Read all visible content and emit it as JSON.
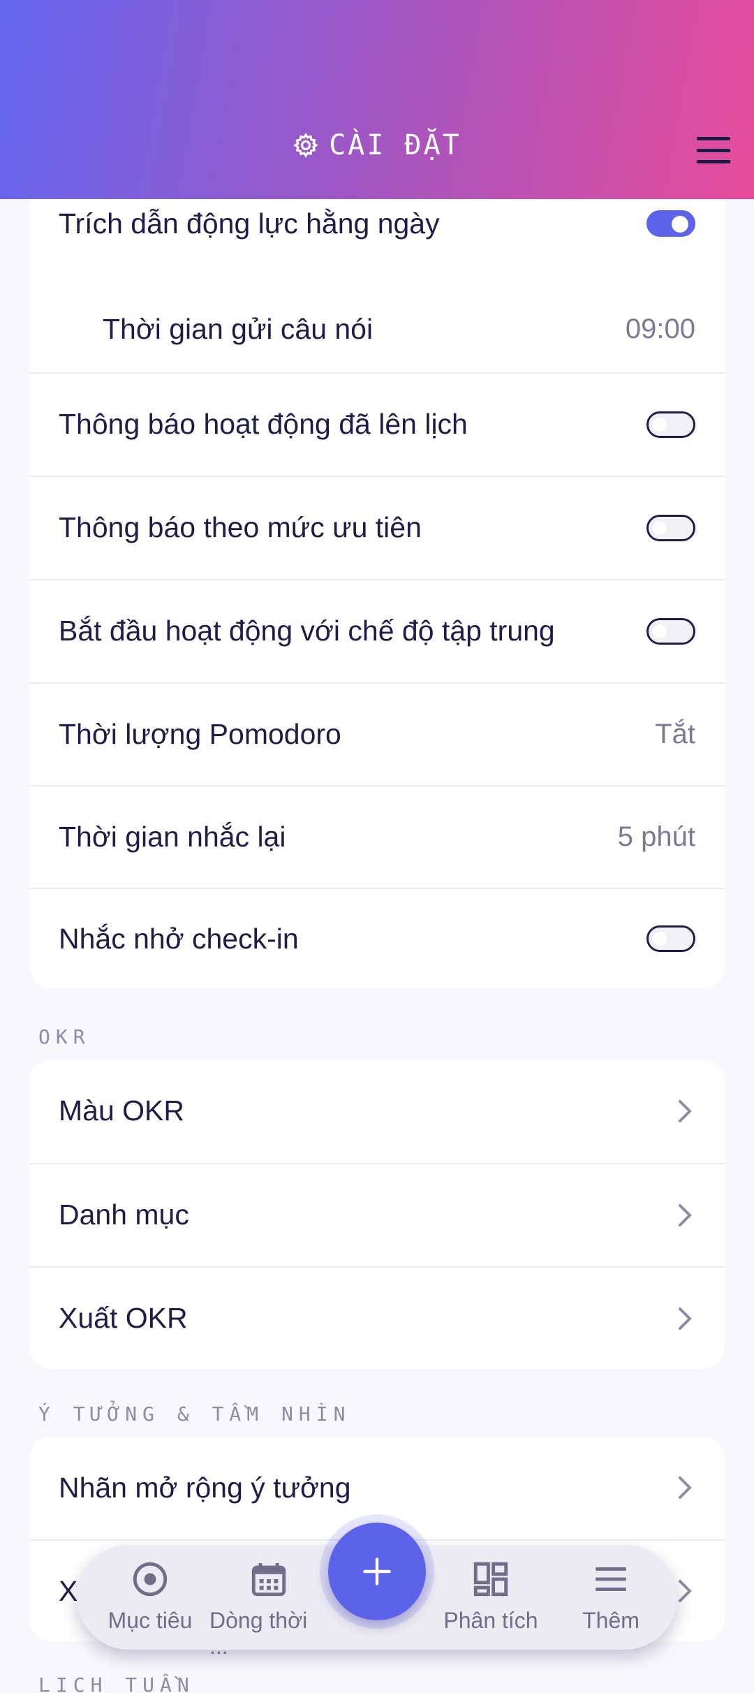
{
  "header": {
    "title": "CÀI ĐẶT",
    "title_icon": "gear-icon",
    "menu_icon": "hamburger-icon"
  },
  "notifications": {
    "daily_quote": {
      "label": "Trích dẫn động lực hằng ngày",
      "toggle": "on"
    },
    "quote_time": {
      "label": "Thời gian gửi câu nói",
      "value": "09:00"
    },
    "scheduled_activity": {
      "label": "Thông báo hoạt động đã lên lịch",
      "toggle": "off"
    },
    "priority": {
      "label": "Thông báo theo mức ưu tiên",
      "toggle": "off"
    },
    "focus_mode": {
      "label": "Bắt đầu hoạt động với chế độ tập trung",
      "toggle": "off"
    },
    "pomodoro": {
      "label": "Thời lượng Pomodoro",
      "value": "Tắt"
    },
    "snooze": {
      "label": "Thời gian nhắc lại",
      "value": "5 phút"
    },
    "checkin": {
      "label": "Nhắc nhở check-in",
      "toggle": "off"
    }
  },
  "okr_section": {
    "label": "OKR",
    "items": [
      "Màu OKR",
      "Danh mục",
      "Xuất OKR"
    ]
  },
  "ideas_section": {
    "label": "Ý TƯỞNG & TẦM NHÌN",
    "items": [
      "Nhãn mở rộng ý tưởng",
      "X"
    ]
  },
  "weekly_section": {
    "label": "LỊCH TUẦN"
  },
  "bottom_nav": {
    "items": [
      {
        "label": "Mục tiêu",
        "icon": "target-icon"
      },
      {
        "label": "Dòng thời ...",
        "icon": "calendar-icon"
      },
      {
        "label": "Phân tích",
        "icon": "dashboard-icon"
      },
      {
        "label": "Thêm",
        "icon": "menu-lines-icon"
      }
    ],
    "fab_icon": "plus-icon"
  },
  "colors": {
    "accent": "#5c63e8",
    "gradient_start": "#6467ef",
    "gradient_end": "#e74c9a",
    "text": "#1f1d47"
  }
}
